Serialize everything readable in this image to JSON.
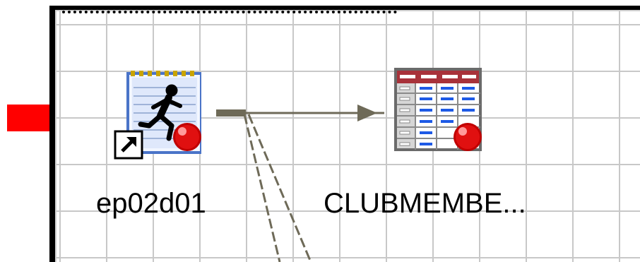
{
  "diagram": {
    "nodes": [
      {
        "type": "job-shortcut",
        "icon": "job-running-icon",
        "label": "ep02d01"
      },
      {
        "type": "table",
        "icon": "table-icon",
        "label": "CLUBMEMBE..."
      }
    ]
  },
  "colors": {
    "pointer": "#ff0000",
    "grid": "#c8c8c8",
    "connector": "#6e6a58",
    "status_ball": "#d40000"
  }
}
